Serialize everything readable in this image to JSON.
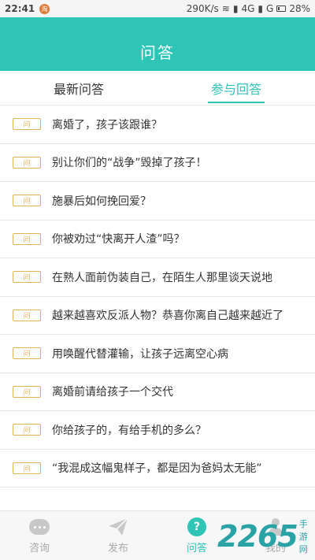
{
  "status_bar": {
    "time": "22:41",
    "app_icon_glyph": "淘",
    "speed": "290K/s",
    "network": "4G",
    "network2": "G",
    "battery": "28%"
  },
  "header": {
    "title": "问答"
  },
  "tabs": [
    {
      "label": "最新问答",
      "active": false
    },
    {
      "label": "参与回答",
      "active": true
    }
  ],
  "badge_label": "问",
  "questions": [
    "离婚了，孩子该跟谁？",
    "别让你们的“战争”毁掉了孩子！",
    "施暴后如何挽回爱？",
    "你被劝过“快离开人渣”吗？",
    "在熟人面前伪装自己，在陌生人那里谈天说地",
    "越来越喜欢反派人物？恭喜你离自己越来越近了",
    "用唤醒代替灌输，让孩子远离空心病",
    "离婚前请给孩子一个交代",
    "你给孩子的，有给手机的多么？",
    "“我混成这幅鬼样子，都是因为爸妈太无能”"
  ],
  "bottom_nav": [
    {
      "label": "咨询",
      "icon": "chat-icon"
    },
    {
      "label": "发布",
      "icon": "paper-plane-icon"
    },
    {
      "label": "问答",
      "icon": "question-icon",
      "active": true
    },
    {
      "label": "我的",
      "icon": "user-icon"
    }
  ],
  "watermark": {
    "big": "2265",
    "small": "手游网"
  },
  "colors": {
    "accent": "#2ec4b6",
    "badge": "#e0b45a"
  }
}
